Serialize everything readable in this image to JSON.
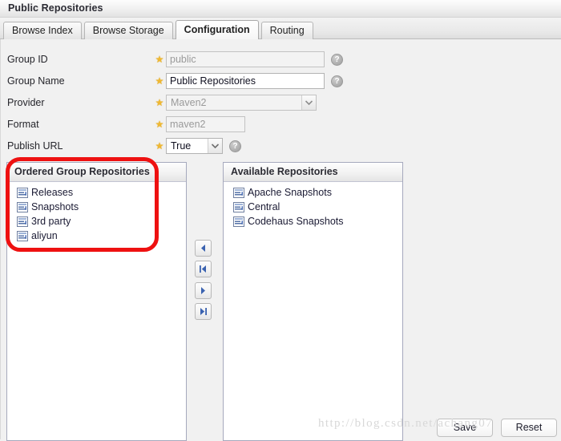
{
  "window": {
    "title": "Public Repositories"
  },
  "tabs": [
    {
      "label": "Browse Index",
      "active": false
    },
    {
      "label": "Browse Storage",
      "active": false
    },
    {
      "label": "Configuration",
      "active": true
    },
    {
      "label": "Routing",
      "active": false
    }
  ],
  "form": {
    "fields": [
      {
        "label": "Group ID",
        "required_icon": "star-icon",
        "control": "text",
        "value": "public",
        "disabled": true,
        "help_icon": "help-icon",
        "has_help": true
      },
      {
        "label": "Group Name",
        "required_icon": "star-icon",
        "control": "text",
        "value": "Public Repositories",
        "disabled": false,
        "help_icon": "help-icon",
        "has_help": true
      },
      {
        "label": "Provider",
        "required_icon": "star-icon",
        "control": "select",
        "value": "Maven2",
        "disabled": true,
        "has_help": false
      },
      {
        "label": "Format",
        "required_icon": "star-icon",
        "control": "text",
        "value": "maven2",
        "disabled": true,
        "has_help": false
      },
      {
        "label": "Publish URL",
        "required_icon": "star-icon",
        "control": "select",
        "value": "True",
        "disabled": false,
        "help_icon": "help-icon",
        "has_help": true
      }
    ]
  },
  "ordered_group": {
    "header": "Ordered Group Repositories",
    "items": [
      {
        "label": "Releases",
        "icon": "repository-icon"
      },
      {
        "label": "Snapshots",
        "icon": "repository-icon"
      },
      {
        "label": "3rd party",
        "icon": "repository-icon"
      },
      {
        "label": "aliyun",
        "icon": "repository-icon"
      }
    ]
  },
  "available": {
    "header": "Available Repositories",
    "items": [
      {
        "label": "Apache Snapshots",
        "icon": "repository-icon"
      },
      {
        "label": "Central",
        "icon": "repository-icon"
      },
      {
        "label": "Codehaus Snapshots",
        "icon": "repository-icon"
      }
    ]
  },
  "transfer_buttons": [
    {
      "name": "move-left-button",
      "icon": "arrow-left-icon"
    },
    {
      "name": "move-all-left-button",
      "icon": "arrow-left-all-icon"
    },
    {
      "name": "move-right-button",
      "icon": "arrow-right-icon"
    },
    {
      "name": "move-all-right-button",
      "icon": "arrow-right-all-icon"
    }
  ],
  "footer": {
    "save_label": "Save",
    "reset_label": "Reset"
  },
  "watermark": {
    "text": "http://blog.csdn.net/achang07"
  },
  "annotation": {
    "shape": "red-rounded-rectangle",
    "color": "#ee1111",
    "targets": "ordered-group-repositories-panel"
  },
  "colors": {
    "accent_red": "#ee1111",
    "star_gold": "#f0b832",
    "icon_blue": "#3a62b0",
    "panel_bg": "#f1f1f1"
  }
}
